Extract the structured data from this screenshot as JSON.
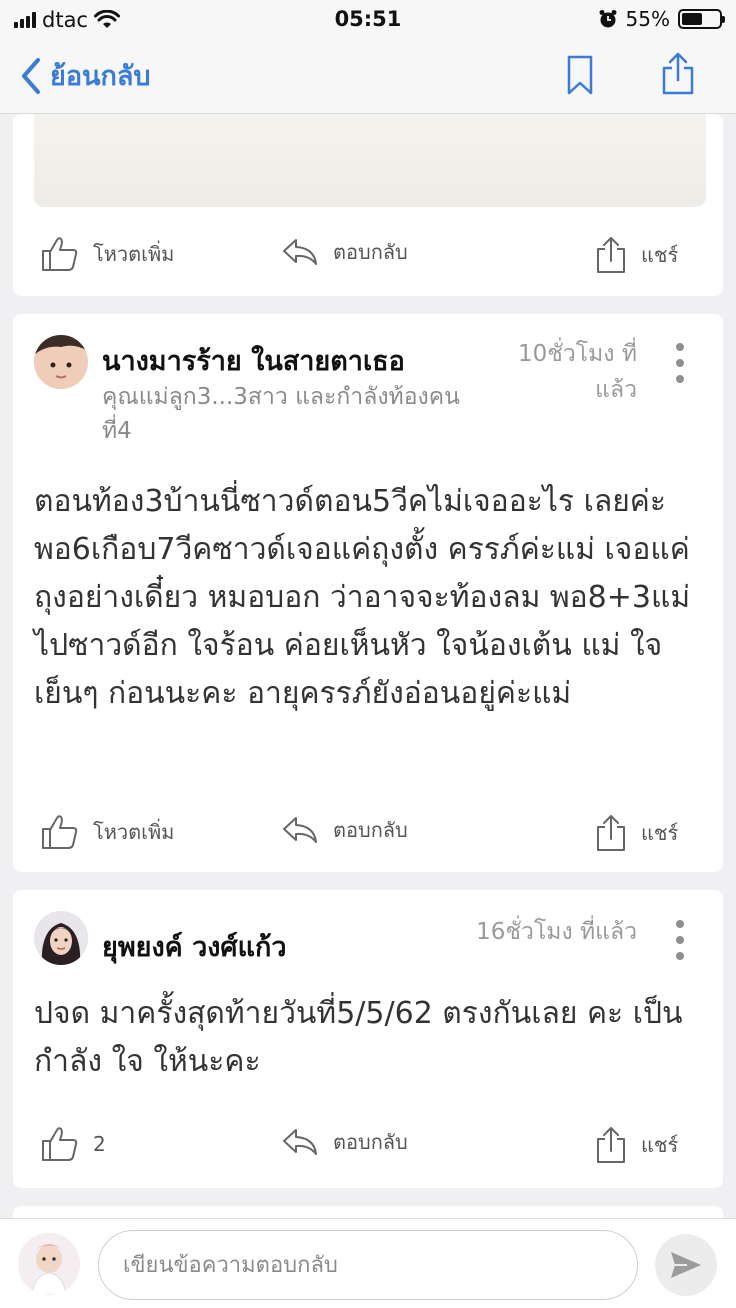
{
  "status_bar": {
    "carrier": "dtac",
    "time": "05:51",
    "battery": "55%",
    "battery_level": 0.55
  },
  "nav": {
    "back_label": "ย้อนกลับ"
  },
  "actions": {
    "like": "โหวตเพิ่ม",
    "reply": "ตอบกลับ",
    "share": "แชร์"
  },
  "comments": [
    {
      "author": "นางมารร้าย ในสายตาเธอ",
      "subtitle": "คุณแม่ลูก3...3สาว และกำลังท้องคนที่4",
      "time_line1": "10ชั่วโมง ที่",
      "time_line2": "แล้ว",
      "body": "ตอนท้อง3บ้านนี่ซาวด์ตอน5วีคไม่เจออะไร เลยค่ะ พอ6เกือบ7วีคซาวด์เจอแค่ถุงตั้ง ครรภ์ค่ะแม่ เจอแค่ถุงอย่างเดี๋ยว หมอบอก ว่าอาจจะท้องลม พอ8+3แม่ไปซาวด์อีก ใจร้อน ค่อยเห็นหัว ใจน้องเต้น แม่ ใจเย็นๆ ก่อนนะคะ อายุครรภ์ยังอ่อนอยู่ค่ะแม่",
      "like_label": "โหวตเพิ่ม"
    },
    {
      "author": "ยุพยงค์ วงศ์แก้ว",
      "time_line1": "16ชั่วโมง ที่แล้ว",
      "body": "ปจด มาครั้งสุดท้ายวันที่5/5/62 ตรงกันเลย คะ เป็นกำลัง ใจ ให้นะคะ",
      "like_label": "2"
    }
  ],
  "reply_box": {
    "placeholder": "เขียนข้อความตอบกลับ"
  },
  "colors": {
    "accent": "#3a7bd5",
    "background": "#f0f0f2",
    "card": "#ffffff",
    "muted_text": "#8a8a8a"
  }
}
